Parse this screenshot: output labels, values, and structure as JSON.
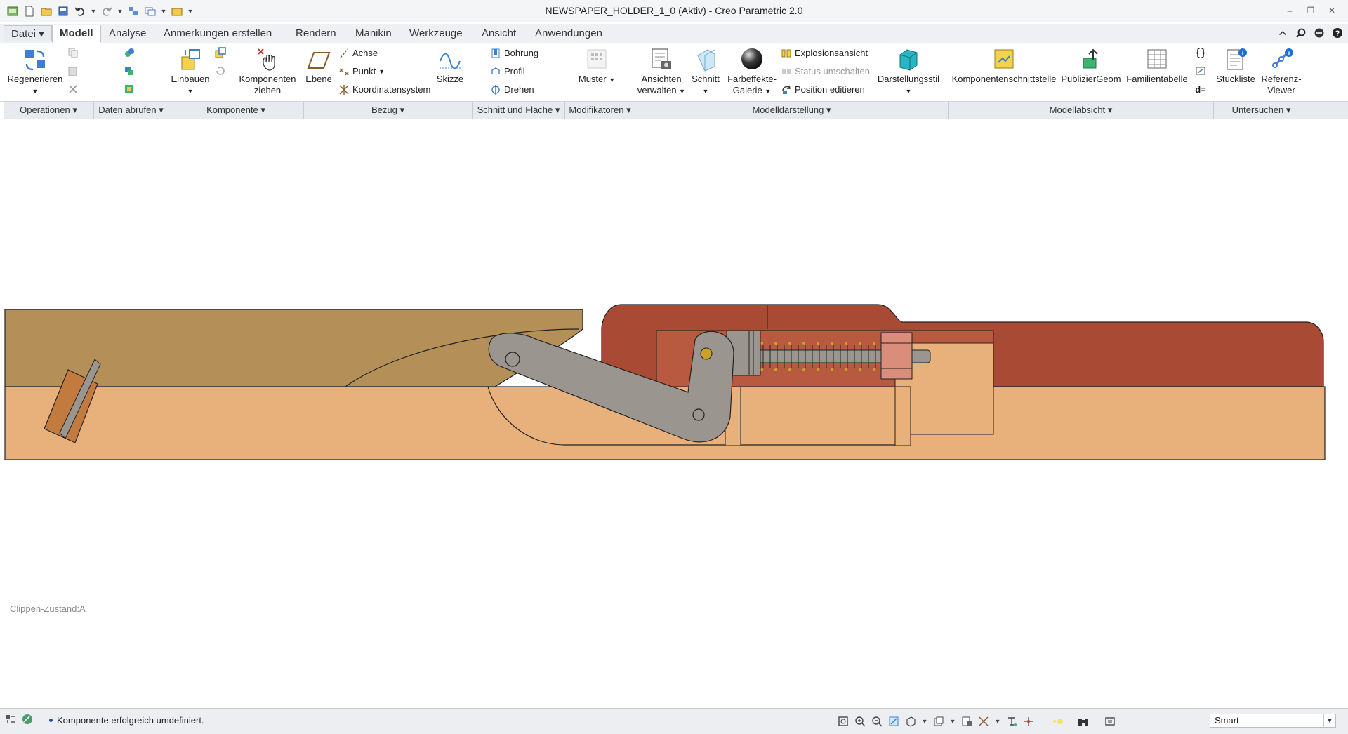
{
  "window": {
    "title": "NEWSPAPER_HOLDER_1_0 (Aktiv) - Creo Parametric 2.0"
  },
  "tabs": [
    {
      "label": "Datei"
    },
    {
      "label": "Modell"
    },
    {
      "label": "Analyse"
    },
    {
      "label": "Anmerkungen erstellen"
    },
    {
      "label": "Rendern"
    },
    {
      "label": "Manikin"
    },
    {
      "label": "Werkzeuge"
    },
    {
      "label": "Ansicht"
    },
    {
      "label": "Anwendungen"
    }
  ],
  "ribbon": {
    "regenerieren": "Regenerieren",
    "einbauen": "Einbauen",
    "komponenten_l1": "Komponenten",
    "komponenten_l2": "ziehen",
    "ebene": "Ebene",
    "achse": "Achse",
    "punkt": "Punkt",
    "koordinatensystem": "Koordinatensystem",
    "skizze": "Skizze",
    "bohrung": "Bohrung",
    "profil": "Profil",
    "drehen": "Drehen",
    "muster": "Muster",
    "ansichten_l1": "Ansichten",
    "ansichten_l2": "verwalten",
    "schnitt": "Schnitt",
    "farbeffekte_l1": "Farbeffekte-",
    "farbeffekte_l2": "Galerie",
    "explosionsansicht": "Explosionsansicht",
    "status_umschalten": "Status umschalten",
    "position_editieren": "Position editieren",
    "darstellungsstil": "Darstellungsstil",
    "komponentenschnittstelle": "Komponentenschnittstelle",
    "publiziergeom": "PublizierGeom",
    "familientabelle": "Familientabelle",
    "stueckliste": "Stückliste",
    "referenz_l1": "Referenz-",
    "referenz_l2": "Viewer",
    "d_equals": "d="
  },
  "groups": [
    {
      "label": "Operationen"
    },
    {
      "label": "Daten abrufen"
    },
    {
      "label": "Komponente"
    },
    {
      "label": "Bezug"
    },
    {
      "label": "Schnitt und Fläche"
    },
    {
      "label": "Modifikatoren"
    },
    {
      "label": "Modelldarstellung"
    },
    {
      "label": "Modellabsicht"
    },
    {
      "label": "Untersuchen"
    }
  ],
  "canvas": {
    "clip_state": "Clippen-Zustand:A"
  },
  "status": {
    "message": "Komponente erfolgreich umdefiniert.",
    "filter_value": "Smart"
  },
  "colors": {
    "base_light": "#e8b07a",
    "base_tan": "#b58f58",
    "housing_red": "#a84a34",
    "lever_gray": "#9b9590",
    "pin_gold": "#c9a227",
    "block_pink": "#d98d7a"
  }
}
